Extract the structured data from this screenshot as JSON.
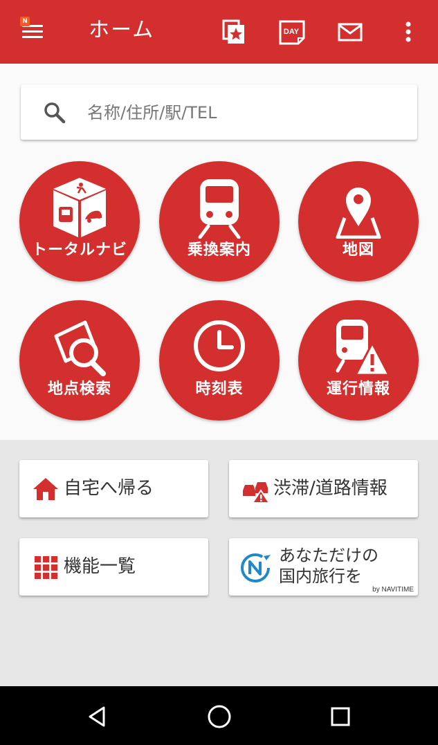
{
  "header": {
    "title": "ホーム",
    "badge": "N",
    "actions": [
      {
        "icon": "favorite-star-icon"
      },
      {
        "icon": "day-calendar-icon",
        "text": "DAY"
      },
      {
        "icon": "mail-icon"
      },
      {
        "icon": "more-vert-icon"
      }
    ]
  },
  "search": {
    "placeholder": "名称/住所/駅/TEL"
  },
  "features": [
    {
      "label": "トータルナビ",
      "icon": "total-navi-icon"
    },
    {
      "label": "乗換案内",
      "icon": "train-icon"
    },
    {
      "label": "地図",
      "icon": "map-pin-icon"
    },
    {
      "label": "地点検索",
      "icon": "place-search-icon"
    },
    {
      "label": "時刻表",
      "icon": "clock-icon"
    },
    {
      "label": "運行情報",
      "icon": "train-alert-icon"
    }
  ],
  "cards": {
    "go_home": "自宅へ帰る",
    "traffic": "渋滞/道路情報",
    "all_features": "機能一覧",
    "travel_line1": "あなただけの",
    "travel_line2": "国内旅行を",
    "travel_by": "by NAVITIME"
  },
  "colors": {
    "brand": "#d32f2f",
    "background": "#e6e6e6",
    "panel": "#fafafa"
  },
  "system_nav": [
    "back-icon",
    "home-icon",
    "recents-icon"
  ]
}
